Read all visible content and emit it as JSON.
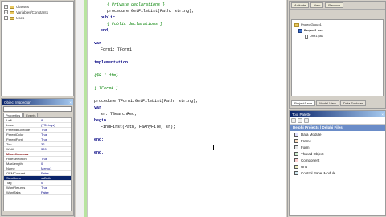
{
  "structure": {
    "items": [
      {
        "label": "Classes"
      },
      {
        "label": "Variables/Constants"
      },
      {
        "label": "Uses"
      }
    ]
  },
  "object_inspector": {
    "title": "Object Inspector",
    "tabs": [
      "Properties",
      "Events"
    ],
    "properties": [
      {
        "name": "Left",
        "value": "8"
      },
      {
        "name": "Less",
        "value": "(TStrings)"
      },
      {
        "name": "ParentBiDiMode",
        "value": "True"
      },
      {
        "name": "ParentColor",
        "value": "True"
      },
      {
        "name": "ParentFont",
        "value": "True"
      },
      {
        "name": "Top",
        "value": "32"
      },
      {
        "name": "Width",
        "value": "320"
      },
      {
        "name": "Miscellaneous",
        "value": ""
      },
      {
        "name": "HideSelection",
        "value": "True"
      },
      {
        "name": "MaxLength",
        "value": "0"
      },
      {
        "name": "Name",
        "value": "Memo1"
      },
      {
        "name": "OEMConvert",
        "value": "False"
      },
      {
        "name": "Scrollbars",
        "value": "ssBoth"
      },
      {
        "name": "Tag",
        "value": "0"
      },
      {
        "name": "WantReturns",
        "value": "True"
      },
      {
        "name": "WantTabs",
        "value": "False"
      }
    ]
  },
  "editor": {
    "lines": [
      {
        "text": "{ Private declarations }",
        "indent": 2,
        "style": "cm"
      },
      {
        "text": "procedure GetFileList(Path: string);",
        "indent": 2,
        "style": ""
      },
      {
        "text": "public",
        "indent": 1,
        "style": "kw"
      },
      {
        "text": "{ Public declarations }",
        "indent": 2,
        "style": "cm"
      },
      {
        "text": "end;",
        "indent": 1,
        "style": "kw"
      },
      {
        "text": "",
        "indent": 0,
        "style": ""
      },
      {
        "text": "var",
        "indent": 0,
        "style": "kw"
      },
      {
        "text": "Form1: TForm1;",
        "indent": 1,
        "style": ""
      },
      {
        "text": "",
        "indent": 0,
        "style": ""
      },
      {
        "text": "implementation",
        "indent": 0,
        "style": "kw"
      },
      {
        "text": "",
        "indent": 0,
        "style": ""
      },
      {
        "text": "{$R *.dfm}",
        "indent": 0,
        "style": "cm"
      },
      {
        "text": "",
        "indent": 0,
        "style": ""
      },
      {
        "text": "{ TForm1 }",
        "indent": 0,
        "style": "cm"
      },
      {
        "text": "",
        "indent": 0,
        "style": ""
      },
      {
        "text": "procedure TForm1.GetFileList(Path: string);",
        "indent": 0,
        "style": ""
      },
      {
        "text": "var",
        "indent": 0,
        "style": "kw"
      },
      {
        "text": "sr: TSearchRec;",
        "indent": 1,
        "style": ""
      },
      {
        "text": "begin",
        "indent": 0,
        "style": "kw"
      },
      {
        "text": "FindFirst(Path, FaAnyFile, sr);",
        "indent": 1,
        "style": ""
      },
      {
        "text": "",
        "indent": 0,
        "style": ""
      },
      {
        "text": "end;",
        "indent": 0,
        "style": "kw"
      },
      {
        "text": "",
        "indent": 0,
        "style": ""
      },
      {
        "text": "end.",
        "indent": 0,
        "style": "kw"
      }
    ]
  },
  "project_manager": {
    "toolbar": [
      "Activate",
      "New",
      "Remove"
    ],
    "nodes": [
      {
        "label": "ProjectGroup1",
        "level": 0,
        "icon": "group"
      },
      {
        "label": "Project1.exe",
        "level": 1,
        "icon": "project"
      },
      {
        "label": "Unit1.pas",
        "level": 2,
        "icon": "file"
      }
    ],
    "tabs": [
      "Project1.exe",
      "Model View",
      "Data Explorer"
    ]
  },
  "tool_palette": {
    "title": "Tool Palette",
    "category": "Delphi Projects | Delphi Files",
    "items": [
      {
        "label": "Data Module"
      },
      {
        "label": "Frame"
      },
      {
        "label": "Form"
      },
      {
        "label": "Thread Object"
      },
      {
        "label": "Component"
      },
      {
        "label": "Unit"
      },
      {
        "label": "Control Panel Module"
      }
    ]
  }
}
